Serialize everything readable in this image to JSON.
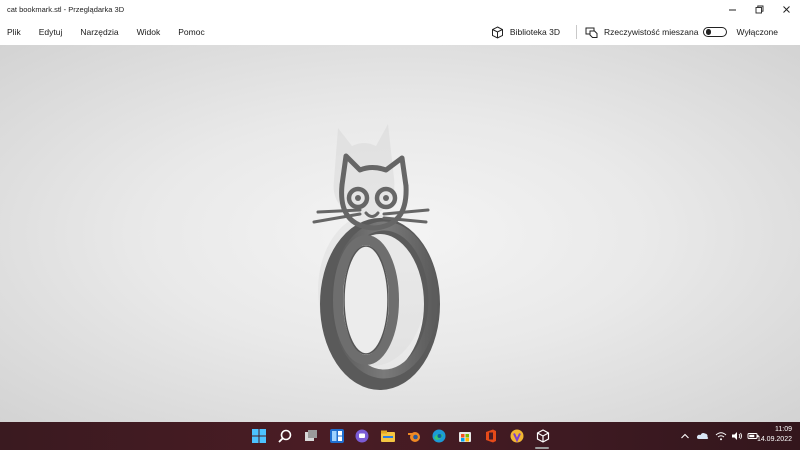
{
  "window": {
    "title": "cat bookmark.stl - Przeglądarka 3D",
    "controls": [
      "minimize",
      "maximize",
      "close"
    ]
  },
  "menu": {
    "items": [
      "Plik",
      "Edytuj",
      "Narzędzia",
      "Widok",
      "Pomoc"
    ],
    "library_label": "Biblioteka 3D",
    "mixed_reality_label": "Rzeczywistość mieszana",
    "toggle_state_label": "Wyłączone",
    "toggle_on": false
  },
  "viewport": {
    "model_name": "cat bookmark.stl",
    "model_color": "#6b6b6b",
    "background_center": "#f4f4f4",
    "background_edge": "#d3d3d3"
  },
  "taskbar": {
    "icons": [
      "windows-start-icon",
      "search-icon",
      "task-view-icon",
      "widgets-icon",
      "chat-icon",
      "file-explorer-icon",
      "blender-icon",
      "edge-icon",
      "store-icon",
      "office-icon",
      "vpn-icon",
      "3d-viewer-icon"
    ],
    "clock": {
      "time": "11:09",
      "date": "14.09.2022"
    },
    "background": "#3f1a21",
    "active_indicator_color": "#9c9c9c"
  }
}
